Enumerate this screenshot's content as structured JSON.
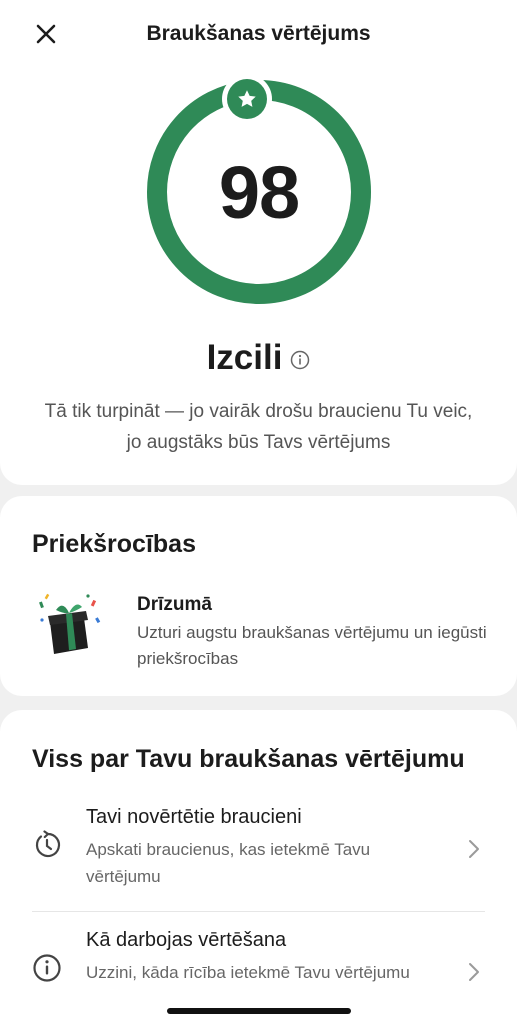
{
  "header": {
    "title": "Braukšanas vērtējums",
    "close_icon": "close-icon"
  },
  "score": {
    "value": "98",
    "progress_fraction": 0.98,
    "ring_color": "#2f8a57",
    "badge_icon": "star-icon",
    "rating_label": "Izcili",
    "rating_info_icon": "info-icon",
    "description": "Tā tik turpināt — jo vairāk drošu braucienu Tu veic, jo augstāks būs Tavs vērtējums"
  },
  "benefits": {
    "title": "Priekšrocības",
    "item": {
      "icon": "gift-icon",
      "title": "Drīzumā",
      "description": "Uzturi augstu braukšanas vērtējumu un iegūsti priekšrocības"
    }
  },
  "about": {
    "title": "Viss par Tavu braukšanas vērtējumu",
    "items": [
      {
        "icon": "history-icon",
        "title": "Tavi novērtētie braucieni",
        "description": "Apskati braucienus, kas ietekmē Tavu vērtējumu",
        "chevron": "chevron-right-icon"
      },
      {
        "icon": "info-icon",
        "title": "Kā darbojas vērtēšana",
        "description": "Uzzini, kāda rīcība ietekmē Tavu vērtējumu",
        "chevron": "chevron-right-icon"
      }
    ]
  },
  "colors": {
    "accent": "#2f8a57",
    "background": "#f0f0f0",
    "card": "#ffffff"
  }
}
